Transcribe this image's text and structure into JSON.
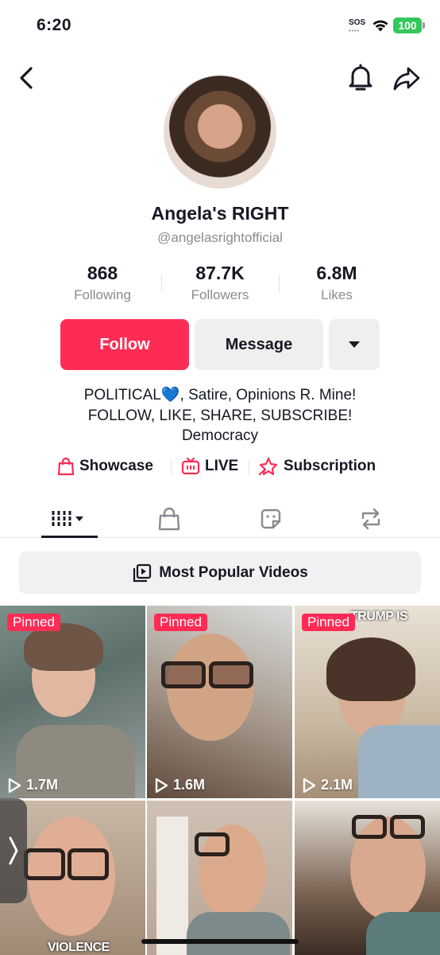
{
  "status_bar": {
    "time": "6:20",
    "sos": "SOS",
    "battery": "100"
  },
  "nav": {
    "back_icon": "chevron-left-icon",
    "bell_icon": "bell-icon",
    "share_icon": "share-arrow-icon"
  },
  "profile": {
    "display_name": "Angela's RIGHT",
    "handle": "@angelasrightofficial",
    "stats": [
      {
        "value": "868",
        "label": "Following"
      },
      {
        "value": "87.7K",
        "label": "Followers"
      },
      {
        "value": "6.8M",
        "label": "Likes"
      }
    ],
    "follow_label": "Follow",
    "message_label": "Message",
    "bio_line1_a": "POLITICAL",
    "bio_heart": "💙",
    "bio_line1_b": ", Satire, Opinions R. Mine!",
    "bio_line2": "FOLLOW, LIKE, SHARE, SUBSCRIBE!",
    "bio_line3": "Democracy",
    "links": [
      {
        "label": "Showcase",
        "icon": "shopping-bag-icon"
      },
      {
        "label": "LIVE",
        "icon": "tv-icon"
      },
      {
        "label": "Subscription",
        "icon": "star-badge-icon"
      }
    ]
  },
  "tabs": [
    {
      "name": "videos",
      "icon": "grid-bars-icon",
      "active": true
    },
    {
      "name": "shop",
      "icon": "bag-icon"
    },
    {
      "name": "favorites",
      "icon": "sticker-icon"
    },
    {
      "name": "reposts",
      "icon": "repost-icon"
    }
  ],
  "most_popular_label": "Most Popular Videos",
  "videos": [
    {
      "pinned": "Pinned",
      "views": "1.7M"
    },
    {
      "pinned": "Pinned",
      "views": "1.6M"
    },
    {
      "pinned": "Pinned",
      "views": "2.1M",
      "caption": "TRUMP IS"
    },
    {
      "caption": "VIOLENCE"
    },
    {},
    {}
  ],
  "colors": {
    "accent": "#fe2c55",
    "battery": "#34c759",
    "secondary_text": "#8a8b91"
  }
}
